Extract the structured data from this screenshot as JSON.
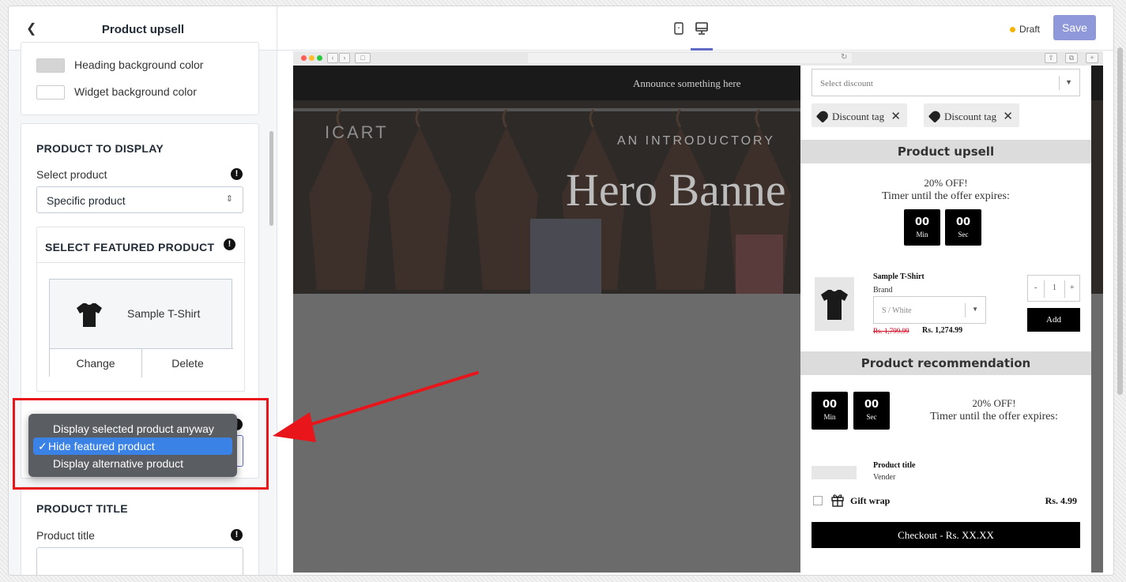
{
  "sidebar": {
    "title": "Product upsell",
    "heading_bg_label": "Heading background color",
    "widget_bg_label": "Widget background color",
    "product_to_display": {
      "heading": "PRODUCT TO DISPLAY",
      "select_label": "Select product",
      "select_value": "Specific product"
    },
    "featured": {
      "heading": "SELECT FEATURED PRODUCT",
      "product_name": "Sample T-Shirt",
      "change_label": "Change",
      "delete_label": "Delete"
    },
    "dropdown_options": [
      {
        "label": "Display selected product anyway",
        "selected": false
      },
      {
        "label": "Hide featured product",
        "selected": true
      },
      {
        "label": "Display alternative product",
        "selected": false
      }
    ],
    "product_title": {
      "heading": "PRODUCT TITLE",
      "label": "Product title"
    }
  },
  "topbar": {
    "status": "Draft",
    "save_label": "Save"
  },
  "preview": {
    "announcement": "Announce something here",
    "logo": "ICART",
    "hero_subtitle": "AN INTRODUCTORY",
    "hero_title": "Hero Banne",
    "drawer": {
      "discount_placeholder": "Select discount",
      "tags": [
        "Discount tag",
        "Discount tag"
      ],
      "upsell_heading": "Product upsell",
      "offer_text": "20% OFF!",
      "timer_text": "Timer until the offer expires:",
      "timer_min": "00",
      "timer_min_label": "Min",
      "timer_sec": "00",
      "timer_sec_label": "Sec",
      "product_title": "Sample T-Shirt",
      "product_brand": "Brand",
      "variant": "S / White",
      "price_old": "Rs. 1,799.99",
      "price_new": "Rs. 1,274.99",
      "qty_minus": "-",
      "qty_value": "1",
      "qty_plus": "+",
      "add_label": "Add",
      "rec_heading": "Product recommendation",
      "rec_offer_text": "20% OFF!",
      "rec_timer_text": "Timer until the offer expires:",
      "rec_product_title": "Product title",
      "rec_vendor": "Vender",
      "gift_label": "Gift wrap",
      "gift_price": "Rs. 4.99",
      "checkout_label": "Checkout - Rs. XX.XX"
    }
  },
  "colors": {
    "accent": "#5c6ac4",
    "save_bg": "#8f98d8",
    "draft_dot": "#f4b400",
    "highlight": "#e8151b",
    "dropdown_selected": "#3b82e6"
  }
}
